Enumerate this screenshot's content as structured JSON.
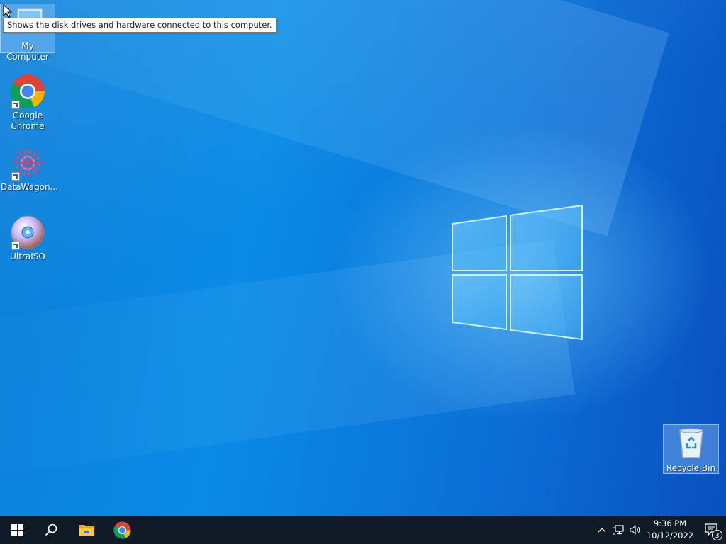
{
  "desktop": {
    "icons": [
      {
        "label": "My Computer",
        "icon": "computer-icon"
      },
      {
        "label": "Google\nChrome",
        "icon": "chrome-icon"
      },
      {
        "label": "DataWagon...",
        "icon": "datawagon-icon"
      },
      {
        "label": "UltraISO",
        "icon": "ultraiso-icon"
      },
      {
        "label": "Recycle Bin",
        "icon": "recycle-bin-icon"
      }
    ],
    "tooltip": "Shows the disk drives and hardware connected to this computer."
  },
  "taskbar": {
    "start": "start-icon",
    "search": "search-icon",
    "pinned": [
      "file-explorer-icon",
      "chrome-icon"
    ],
    "clock": {
      "time": "9:36 PM",
      "date": "10/12/2022"
    },
    "notifications_count": "3"
  },
  "colors": {
    "taskbar": "#101b26",
    "desktop_accent": "#0a8be6"
  }
}
